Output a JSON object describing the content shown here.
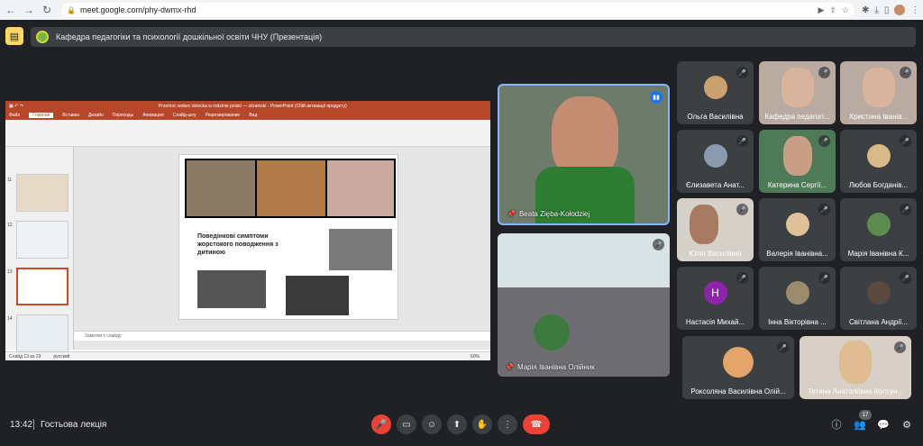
{
  "browser": {
    "url": "meet.google.com/phy-dwmx-rhd"
  },
  "meeting": {
    "banner_title": "Кафедра педагогіки та психології дошкільної освіти ЧНУ (Презентація)",
    "time": "13:42",
    "name": "Гостьова лекція",
    "participant_count": "17"
  },
  "presentation": {
    "window_title": "Przemoc wobec dziecka w rodzinie polski — ukrainski - PowerPoint (Сбій активації продукту)",
    "tabs": [
      "Файл",
      "Главная",
      "Вставка",
      "Дизайн",
      "Переходы",
      "Анимация",
      "Слайд-шоу",
      "Рецензирование",
      "Вид"
    ],
    "active_tab": "Главная",
    "slide_text": "Поведінкові симптоми жорстокого поводження з дитиною",
    "notes_placeholder": "Заметки к слайду",
    "status_slide": "Слайд 13 из 23",
    "status_lang": "русский",
    "status_zoom": "60%",
    "thumb_numbers": [
      "11",
      "12",
      "13",
      "14"
    ]
  },
  "featured": [
    {
      "name": "Beata Zięba-Kołodziej",
      "speaking": true
    },
    {
      "name": "Марія Іванівна Олійник",
      "speaking": false
    }
  ],
  "participants": [
    {
      "name": "Ольга Василівна"
    },
    {
      "name": "Кафедра педагогі..."
    },
    {
      "name": "Христина Іванів..."
    },
    {
      "name": "Єлизавета Анат..."
    },
    {
      "name": "Катерина Сергії..."
    },
    {
      "name": "Любов Богданів..."
    },
    {
      "name": "Юлія Василівна"
    },
    {
      "name": "Валерія Іванівна..."
    },
    {
      "name": "Марія Іванівна К..."
    },
    {
      "name": "Настасія Михай...",
      "initial": "Н"
    },
    {
      "name": "Інна Вікторівна ..."
    },
    {
      "name": "Світлана Андрії..."
    },
    {
      "name": "Роксоляна Василівна Олій..."
    },
    {
      "name": "Тетяна Анатоліївна Колтун..."
    }
  ],
  "colors": {
    "meet_bg": "#202124",
    "tile_bg": "#3c4043",
    "end_call": "#ea4335",
    "speaking": "#1a73e8",
    "presenting_icon": "#fdd663",
    "avatar_h": "#8e24aa"
  }
}
